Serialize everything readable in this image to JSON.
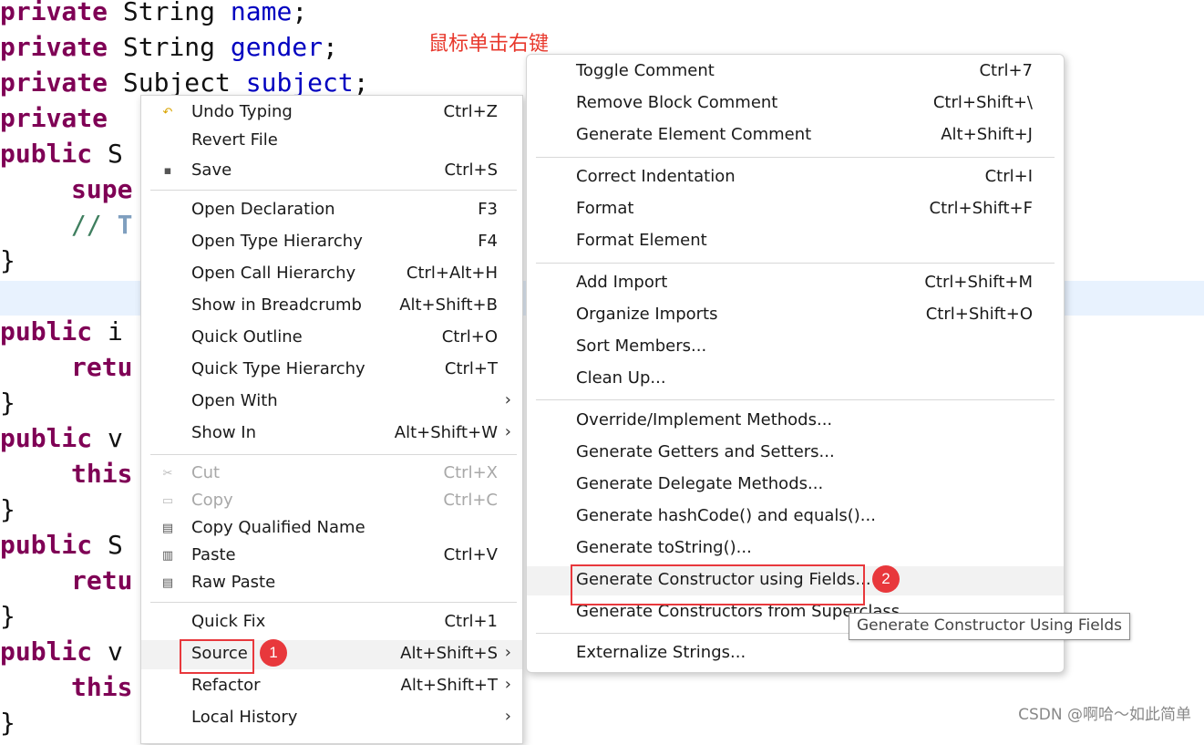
{
  "editor": {
    "lines": [
      {
        "kw": "private",
        "rest": " String ",
        "field": "name",
        "tail": ";"
      },
      {
        "kw": "private",
        "rest": " String ",
        "field": "gender",
        "tail": ";"
      },
      {
        "kw": "private",
        "rest": " Subject ",
        "field": "subject",
        "tail": ";"
      },
      {
        "kw": "private",
        "rest": "",
        "field": "",
        "tail": ""
      },
      {
        "kw": "public",
        "rest": " S",
        "field": "",
        "tail": ""
      },
      {
        "kw": "supe",
        "rest": "",
        "field": "",
        "tail": ""
      },
      {
        "comment": "// ",
        "tag": "T"
      },
      {
        "plain": "}"
      },
      {
        "plain": ""
      },
      {
        "kw": "public",
        "rest": " i",
        "field": "",
        "tail": ""
      },
      {
        "kw": "retu",
        "rest": "",
        "field": "",
        "tail": ""
      },
      {
        "plain": "}"
      },
      {
        "kw": "public",
        "rest": " v",
        "field": "",
        "tail": ""
      },
      {
        "kw": "this",
        "rest": "",
        "field": "",
        "tail": ""
      },
      {
        "plain": "}"
      },
      {
        "kw": "public",
        "rest": " S",
        "field": "",
        "tail": ""
      },
      {
        "kw": "retu",
        "rest": "",
        "field": "",
        "tail": ""
      },
      {
        "plain": "}"
      },
      {
        "kw": "public",
        "rest": " v",
        "field": "",
        "tail": ""
      },
      {
        "kw": "this",
        "rest": "",
        "field": "",
        "tail": ""
      },
      {
        "plain": "}"
      }
    ],
    "annotation": "鼠标单击右键"
  },
  "context_menu": {
    "items": [
      {
        "label": "Undo Typing",
        "shortcut": "Ctrl+Z",
        "icon": "undo-icon"
      },
      {
        "label": "Revert File",
        "shortcut": ""
      },
      {
        "label": "Save",
        "shortcut": "Ctrl+S",
        "icon": "save-icon"
      },
      {
        "label": "Open Declaration",
        "shortcut": "F3"
      },
      {
        "label": "Open Type Hierarchy",
        "shortcut": "F4"
      },
      {
        "label": "Open Call Hierarchy",
        "shortcut": "Ctrl+Alt+H"
      },
      {
        "label": "Show in Breadcrumb",
        "shortcut": "Alt+Shift+B"
      },
      {
        "label": "Quick Outline",
        "shortcut": "Ctrl+O"
      },
      {
        "label": "Quick Type Hierarchy",
        "shortcut": "Ctrl+T"
      },
      {
        "label": "Open With",
        "shortcut": "",
        "submenu": true
      },
      {
        "label": "Show In",
        "shortcut": "Alt+Shift+W",
        "submenu": true
      },
      {
        "label": "Cut",
        "shortcut": "Ctrl+X",
        "disabled": true,
        "icon": "cut-icon"
      },
      {
        "label": "Copy",
        "shortcut": "Ctrl+C",
        "disabled": true,
        "icon": "copy-icon"
      },
      {
        "label": "Copy Qualified Name",
        "shortcut": "",
        "icon": "copy-qualified-icon"
      },
      {
        "label": "Paste",
        "shortcut": "Ctrl+V",
        "icon": "paste-icon"
      },
      {
        "label": "Raw Paste",
        "shortcut": "",
        "icon": "raw-paste-icon"
      },
      {
        "label": "Quick Fix",
        "shortcut": "Ctrl+1"
      },
      {
        "label": "Source",
        "shortcut": "Alt+Shift+S",
        "submenu": true,
        "active": true
      },
      {
        "label": "Refactor",
        "shortcut": "Alt+Shift+T",
        "submenu": true
      },
      {
        "label": "Local History",
        "shortcut": "",
        "submenu": true
      }
    ]
  },
  "source_submenu": {
    "items": [
      {
        "label": "Toggle Comment",
        "shortcut": "Ctrl+7"
      },
      {
        "label": "Remove Block Comment",
        "shortcut": "Ctrl+Shift+\\"
      },
      {
        "label": "Generate Element Comment",
        "shortcut": "Alt+Shift+J"
      },
      {
        "label": "Correct Indentation",
        "shortcut": "Ctrl+I"
      },
      {
        "label": "Format",
        "shortcut": "Ctrl+Shift+F"
      },
      {
        "label": "Format Element",
        "shortcut": ""
      },
      {
        "label": "Add Import",
        "shortcut": "Ctrl+Shift+M"
      },
      {
        "label": "Organize Imports",
        "shortcut": "Ctrl+Shift+O"
      },
      {
        "label": "Sort Members...",
        "shortcut": ""
      },
      {
        "label": "Clean Up...",
        "shortcut": ""
      },
      {
        "label": "Override/Implement Methods...",
        "shortcut": ""
      },
      {
        "label": "Generate Getters and Setters...",
        "shortcut": ""
      },
      {
        "label": "Generate Delegate Methods...",
        "shortcut": ""
      },
      {
        "label": "Generate hashCode() and equals()...",
        "shortcut": ""
      },
      {
        "label": "Generate toString()...",
        "shortcut": ""
      },
      {
        "label": "Generate Constructor using Fields...",
        "shortcut": "",
        "active": true
      },
      {
        "label": "Generate Constructors from Superclass...",
        "shortcut": ""
      },
      {
        "label": "Externalize Strings...",
        "shortcut": ""
      }
    ]
  },
  "markers": {
    "step1": "1",
    "step2": "2"
  },
  "tooltip": "Generate Constructor Using Fields",
  "watermark": "CSDN @啊哈～如此简单",
  "colors": {
    "keyword": "#7f0055",
    "field": "#0000c0",
    "marker": "#e8383c",
    "annotation": "#e8382c"
  }
}
